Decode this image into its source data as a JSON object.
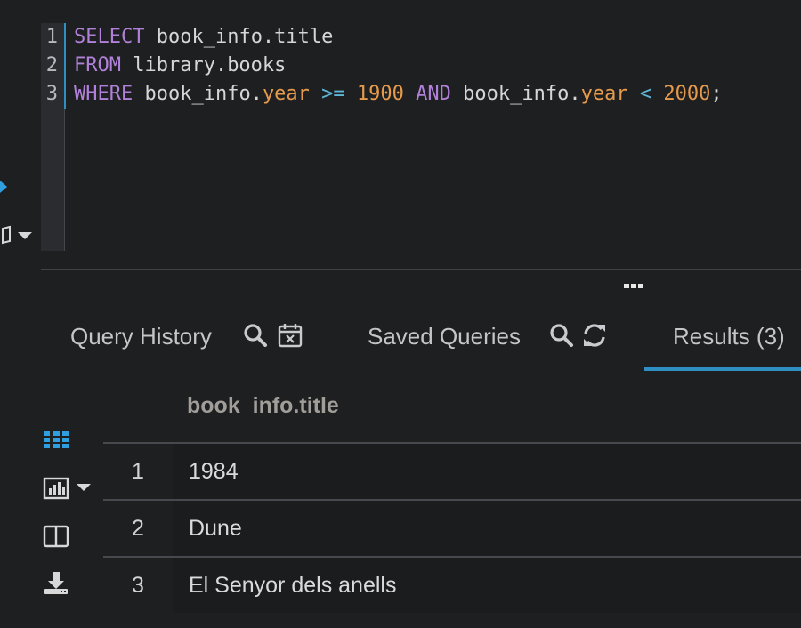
{
  "editor": {
    "line_numbers": [
      "1",
      "2",
      "3"
    ],
    "lines": {
      "l1": {
        "kw1": "SELECT",
        "t1": " book_info.title"
      },
      "l2": {
        "kw1": "FROM",
        "t1": " library.books"
      },
      "l3": {
        "kw1": "WHERE",
        "t1": " book_info.",
        "p1": "year",
        "o1": " >=",
        "sp1": " ",
        "n1": "1900",
        "sp2": " ",
        "kw2": "AND",
        "t2": " book_info.",
        "p2": "year",
        "o2": " <",
        "sp3": " ",
        "n2": "2000",
        "t3": ";"
      }
    }
  },
  "tabs": {
    "query_history": "Query History",
    "saved_queries": "Saved Queries",
    "results": "Results (3)"
  },
  "results": {
    "column_header": "book_info.title",
    "rows": [
      {
        "index": "1",
        "title": "1984"
      },
      {
        "index": "2",
        "title": "Dune"
      },
      {
        "index": "3",
        "title": "El Senyor dels anells"
      }
    ]
  },
  "icons": {
    "run": "play-icon",
    "book": "book-icon",
    "search": "search-icon",
    "calendar": "calendar-icon",
    "refresh": "refresh-icon",
    "grid": "grid-icon",
    "chart": "bar-chart-icon",
    "columns": "columns-icon",
    "download": "download-icon",
    "splitter": "more-horizontal-icon"
  },
  "colors": {
    "background": "#1e1f21",
    "accent": "#2f8ec2",
    "keyword": "#b181d9",
    "number": "#e69b4c",
    "operator": "#5fb7d8"
  }
}
